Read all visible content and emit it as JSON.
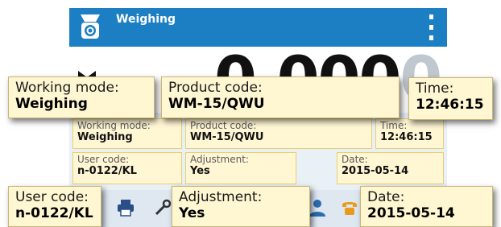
{
  "window": {
    "title": "Weighing"
  },
  "display": {
    "reading_main": "0.000",
    "reading_dim": "0"
  },
  "info_fields": {
    "working_mode": {
      "label": "Working mode:",
      "value": "Weighing"
    },
    "product_code": {
      "label": "Product code:",
      "value": "WM-15/QWU"
    },
    "time": {
      "label": "Time:",
      "value": "12:46:15"
    },
    "user_code": {
      "label": "User code:",
      "value": "n-0122/KL"
    },
    "adjustment": {
      "label": "Adjustment:",
      "value": "Yes"
    },
    "date": {
      "label": "Date:",
      "value": "2015-05-14"
    }
  },
  "icons": {
    "app": "scale-icon",
    "menu": "kebab-menu-icon",
    "stability": "stability-indicator-icon",
    "bottom": [
      "printer-icon",
      "tools-icon",
      "user-icon",
      "phone-icon"
    ]
  },
  "colors": {
    "titlebar": "#1c7fc4",
    "field_background": "#fff6d4",
    "field_border": "#e9cf74",
    "callout_background": "#fff6d2"
  }
}
